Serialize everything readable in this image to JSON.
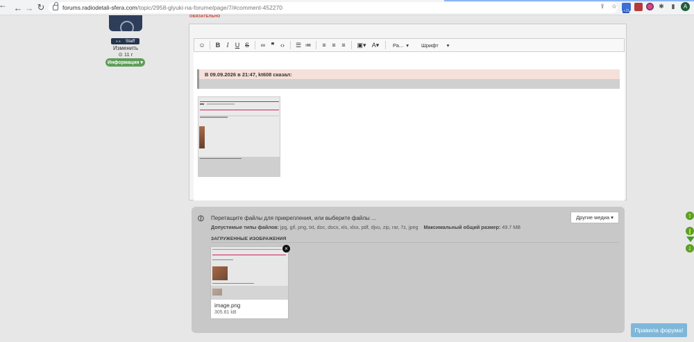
{
  "browser": {
    "url_host": "forums.radiodetali-sfera.com",
    "url_path": "/topic/2958-glyuki-na-forume/page/7/#comment-452270",
    "badge_count": "+15",
    "profile_letter": "A"
  },
  "user": {
    "badge_label": "Staff",
    "edit_label": "Изменить",
    "time_label": "11 г",
    "info_button": "Информация ▾"
  },
  "editor": {
    "required_label": "ОБЯЗАТЕЛЬНО",
    "toolbar": {
      "format_label": "Ра...",
      "font_label": "Шрифт"
    },
    "quote_header": "В 09.09.2026 в 21:47, kt608 сказал:"
  },
  "upload": {
    "prompt": "Перетащите файлы для прикрепления, или выберите файлы ...",
    "types_label": "Допустимые типы файлов:",
    "types_value": " jpg, gif, png, txt, doc, docx, xls, xlsx, pdf, djvu, zip, rar, 7z, jpeg",
    "max_label": "Максимальный общий размер:",
    "max_value": " 49.7 MB",
    "other_media": "Другие медиа ▾",
    "uploaded_title": "ЗАГРУЖЕННЫЕ ИЗОБРАЖЕНИЯ",
    "files": [
      {
        "name": "image.png",
        "size": "305.81 kB"
      }
    ]
  },
  "rules_button": "Правила форума!",
  "colors": {
    "accent_green": "#5e9e59",
    "rules_blue": "#7fb7d9",
    "required_red": "#c0392b"
  }
}
